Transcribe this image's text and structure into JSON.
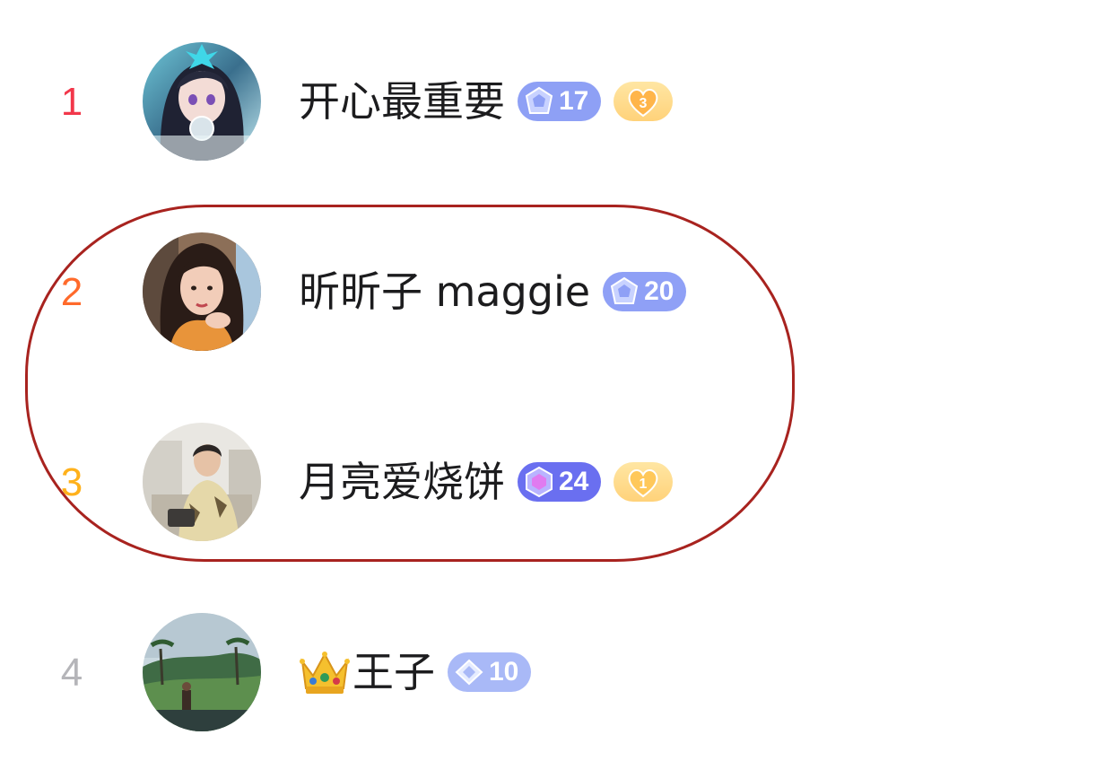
{
  "leaderboard": {
    "entries": [
      {
        "rank": "1",
        "name": "开心最重要",
        "level": "17",
        "heart_level": "3",
        "rank_color": "#f2374a",
        "badge_color": "#8ea0f5",
        "avatar_icon": "anime-girl-avatar"
      },
      {
        "rank": "2",
        "name": "昕昕子 maggie",
        "level": "20",
        "rank_color": "#ff6a2b",
        "badge_color": "#8fa0f6",
        "avatar_icon": "woman-portrait-avatar"
      },
      {
        "rank": "3",
        "name": "月亮爱烧饼",
        "level": "24",
        "heart_level": "1",
        "rank_color": "#ffb11b",
        "badge_color": "#6a6ff0",
        "avatar_icon": "person-seated-avatar"
      },
      {
        "rank": "4",
        "name": "王子",
        "name_prefix_icon": "crown-icon",
        "level": "10",
        "rank_color": "#b5b5b9",
        "badge_color": "#a9b9f7",
        "avatar_icon": "resort-landscape-avatar"
      }
    ]
  },
  "annotation": {
    "color": "#a8231f",
    "circled_ranks": [
      "2",
      "3"
    ]
  }
}
